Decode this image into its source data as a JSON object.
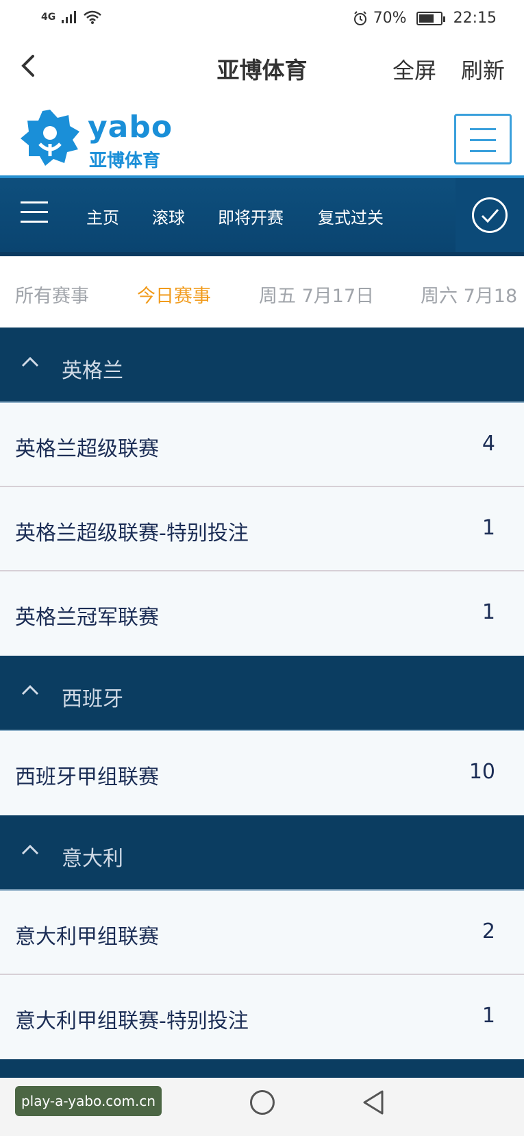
{
  "status_bar": {
    "network": "4G",
    "battery_percent": "70%",
    "battery_level": 0.7,
    "time": "22:15"
  },
  "header": {
    "title": "亚博体育",
    "fullscreen_label": "全屏",
    "refresh_label": "刷新"
  },
  "brand": {
    "logo_en": "yabo",
    "logo_cn": "亚博体育"
  },
  "nav": {
    "items": [
      "主页",
      "滚球",
      "即将开赛",
      "复式过关"
    ]
  },
  "date_tabs": {
    "items": [
      "所有赛事",
      "今日赛事",
      "周五 7月17日",
      "周六 7月18"
    ],
    "active_index": 1
  },
  "leagues": [
    {
      "country": "英格兰",
      "items": [
        {
          "name": "英格兰超级联赛",
          "count": "4"
        },
        {
          "name": "英格兰超级联赛-特别投注",
          "count": "1"
        },
        {
          "name": "英格兰冠军联赛",
          "count": "1"
        }
      ]
    },
    {
      "country": "西班牙",
      "items": [
        {
          "name": "西班牙甲组联赛",
          "count": "10"
        }
      ]
    },
    {
      "country": "意大利",
      "items": [
        {
          "name": "意大利甲组联赛",
          "count": "2"
        },
        {
          "name": "意大利甲组联赛-特别投注",
          "count": "1"
        }
      ]
    }
  ],
  "watermark": "play-a-yabo.com.cn",
  "colors": {
    "nav_bg": "#0e4f7d",
    "country_bg": "#0b3d61",
    "active_tab": "#f19b1c",
    "brand_blue": "#1a8fd8"
  }
}
